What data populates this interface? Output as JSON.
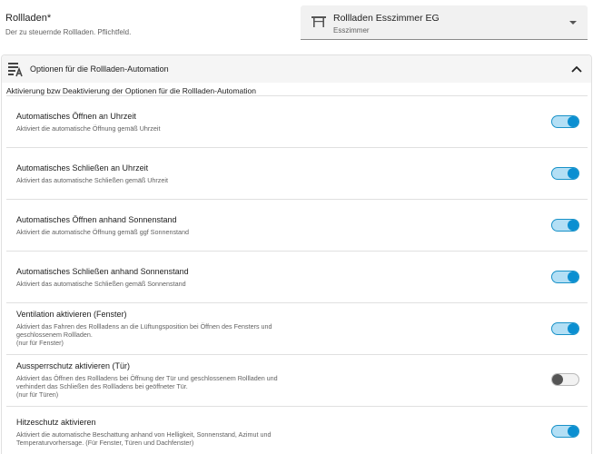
{
  "field": {
    "label": "Rollladen*",
    "help": "Der zu steuernde Rollladen. Pflichtfeld."
  },
  "select": {
    "title": "Rollladen Esszimmer EG",
    "subtitle": "Esszimmer",
    "icon": "table-icon"
  },
  "panel": {
    "title": "Optionen für die Rollladen-Automation",
    "description": "Aktivierung bzw Deaktivierung der Optionen für die Rollladen-Automation",
    "icon": "tune-list-icon",
    "expanded": true
  },
  "options": [
    {
      "title": "Automatisches Öffnen an Uhrzeit",
      "desc": "Aktiviert die automatische Öffnung gemäß Uhrzeit",
      "enabled": true
    },
    {
      "title": "Automatisches Schließen an Uhrzeit",
      "desc": "Aktiviert das automatische Schließen gemäß Uhrzeit",
      "enabled": true
    },
    {
      "title": "Automatisches Öffnen anhand Sonnenstand",
      "desc": "Aktiviert die automatische Öffnung gemäß ggf Sonnenstand",
      "enabled": true
    },
    {
      "title": "Automatisches Schließen anhand Sonnenstand",
      "desc": "Aktiviert das automatische Schließen gemäß Sonnenstand",
      "enabled": true
    },
    {
      "title": "Ventilation aktivieren (Fenster)",
      "desc": "Aktiviert das Fahren des Rollladens an die Lüftungsposition bei Öffnen des Fensters und geschlossenem Rollladen.",
      "note": "(nur für Fenster)",
      "enabled": true
    },
    {
      "title": "Aussperrschutz aktivieren (Tür)",
      "desc": "Aktiviert das Öffnen des Rollladens bei Öffnung der Tür und geschlossenem Rollladen und verhindert das Schließen des Rollladens bei geöffneter Tür.",
      "note": "(nur für Türen)",
      "enabled": false
    },
    {
      "title": "Hitzeschutz aktivieren",
      "desc": "Aktiviert die automatische Beschattung anhand von Helligkeit, Sonnenstand, Azimut und Temperaturvorhersage. (Für Fenster, Türen und Dachfenster)",
      "enabled": true
    }
  ],
  "colors": {
    "toggle_on": "#0b8fd1",
    "toggle_off": "#555555"
  }
}
